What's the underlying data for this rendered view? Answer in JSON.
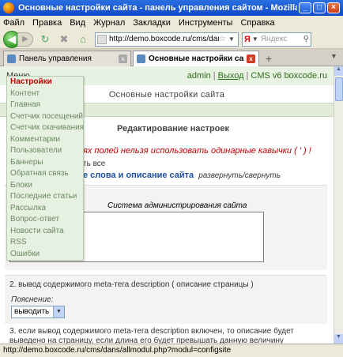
{
  "window": {
    "title": "Основные настройки сайта - панель управления сайтом - Mozilla Firefox",
    "minimize": "_",
    "maximize": "□",
    "close": "×"
  },
  "menubar": [
    "Файл",
    "Правка",
    "Вид",
    "Журнал",
    "Закладки",
    "Инструменты",
    "Справка"
  ],
  "nav": {
    "url": "http://demo.boxcode.ru/cms/dans/allmodul.p",
    "search_engine": "Я",
    "search_placeholder": "Яндекс"
  },
  "tabs": [
    {
      "label": "Панель управления"
    },
    {
      "label": "Основные настройки сайта - па..."
    }
  ],
  "page": {
    "menu_label": "Меню",
    "user": "admin",
    "logout": "Выход",
    "cms_link": "CMS v6 boxcode.ru",
    "title": "Основные настройки сайта",
    "band_text": "ть",
    "section_title": "Редактирование настроек",
    "warning": "ях полей нельзя использовать одинарные кавычки ( ' ) !",
    "expand_all": "ть все",
    "group_title": "е слова и описание сайта",
    "group_toggle": "развернуть/свернуть",
    "field_caption": "Система администрирования сайта",
    "field_value": "рования сайта",
    "q2": "2. вывод содержимого meta-тега description ( описание страницы )",
    "hint": "Пояснение:",
    "select_value": "выводить",
    "q3": "3. если вывод содержимого meta-тега description включен, то описание будет выведено на страницу, если длина его будет превышать данную величину"
  },
  "dropdown": [
    "Настройки",
    "Контент",
    "Главная",
    "Счетчик посещений",
    "Счетчик скачивания",
    "Комментарии",
    "Пользователи",
    "Баннеры",
    "Обратная связь",
    "Блоки",
    "Последние статьи",
    "Рассылка",
    "Вопрос-ответ",
    "Новости сайта",
    "RSS",
    "Ошибки"
  ],
  "status": "http://demo.boxcode.ru/cms/dans/allmodul.php?modul=configsite"
}
